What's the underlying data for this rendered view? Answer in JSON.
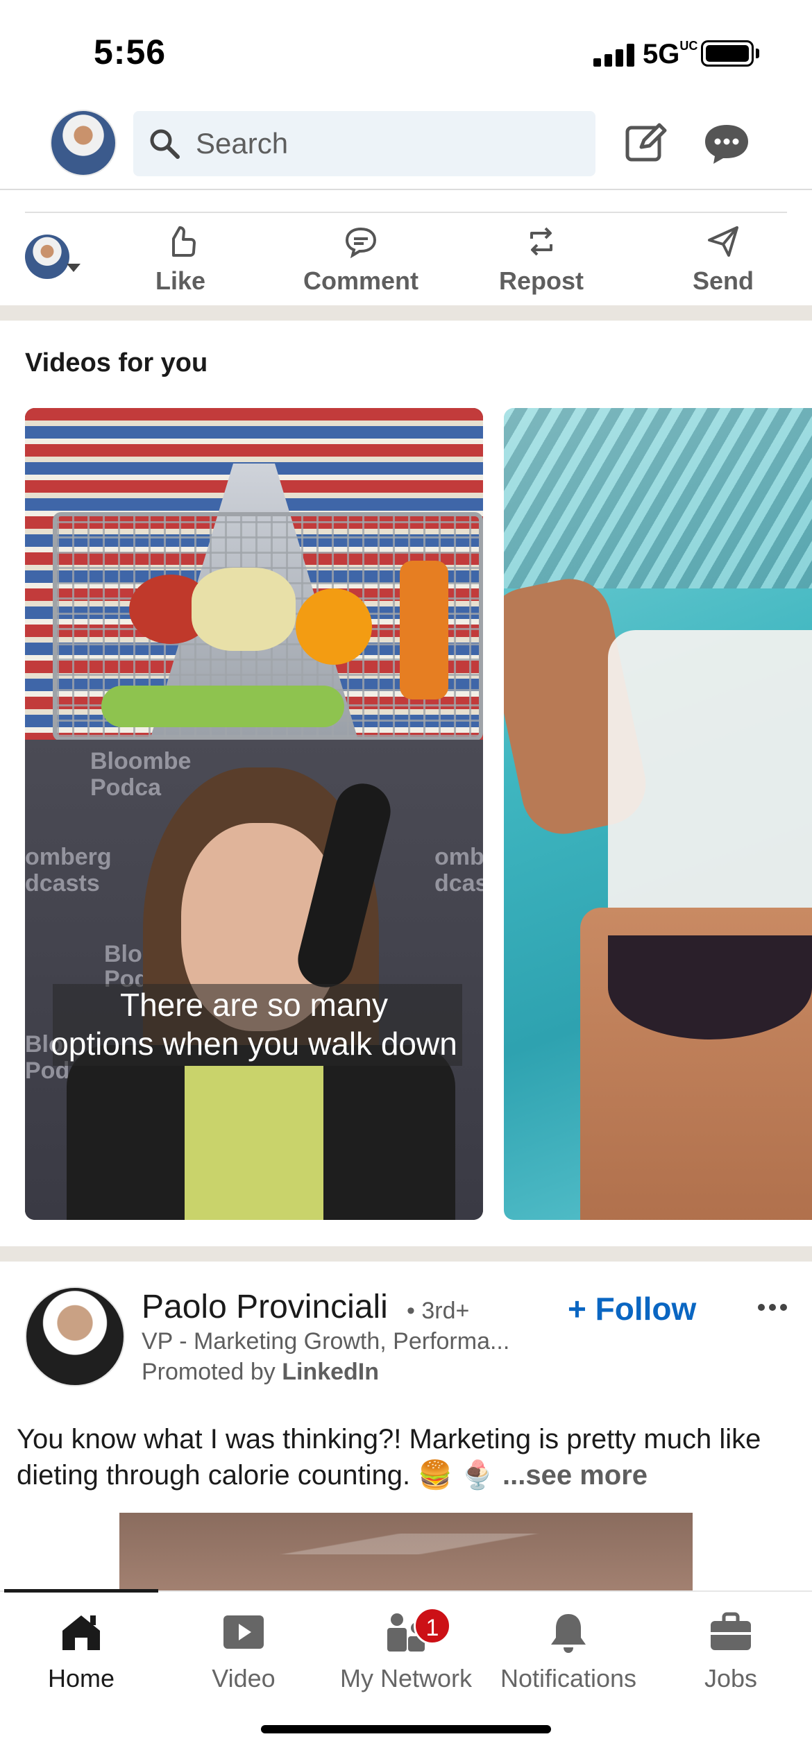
{
  "status_bar": {
    "time": "5:56",
    "network": "5G",
    "network_suffix": "UC"
  },
  "top_bar": {
    "search_placeholder": "Search",
    "icons": [
      "search-icon",
      "compose-icon",
      "messaging-icon"
    ]
  },
  "actions": {
    "like": "Like",
    "comment": "Comment",
    "repost": "Repost",
    "send": "Send"
  },
  "videos": {
    "title": "Videos for you",
    "card1": {
      "caption_line1": "There are so many",
      "caption_line2": "options when you walk down",
      "studio_texts": [
        "Bloombe",
        "Podca",
        "omberg",
        "dcasts",
        "Bloom",
        "Podc",
        "Blo",
        "Podcas",
        "ombe",
        "dcasts"
      ]
    }
  },
  "post": {
    "author_name": "Paolo Provinciali",
    "degree": "• 3rd+",
    "headline": "VP - Marketing Growth, Performa...",
    "promoted_prefix": "Promoted by ",
    "promoted_by": "LinkedIn",
    "follow_label": "+ Follow",
    "text": "You know what I was thinking?! Marketing is pretty much like dieting through calorie counting. 🍔 🍨",
    "see_more": "...see more"
  },
  "bottom_nav": {
    "items": [
      {
        "label": "Home",
        "icon": "home-icon",
        "active": true
      },
      {
        "label": "Video",
        "icon": "video-icon",
        "active": false
      },
      {
        "label": "My Network",
        "icon": "network-icon",
        "active": false,
        "badge": "1"
      },
      {
        "label": "Notifications",
        "icon": "bell-icon",
        "active": false
      },
      {
        "label": "Jobs",
        "icon": "briefcase-icon",
        "active": false
      }
    ]
  },
  "colors": {
    "linkedin_blue": "#0a66c2",
    "badge_red": "#cc1016",
    "icon_gray": "#666666",
    "separator": "#e9e5df"
  }
}
